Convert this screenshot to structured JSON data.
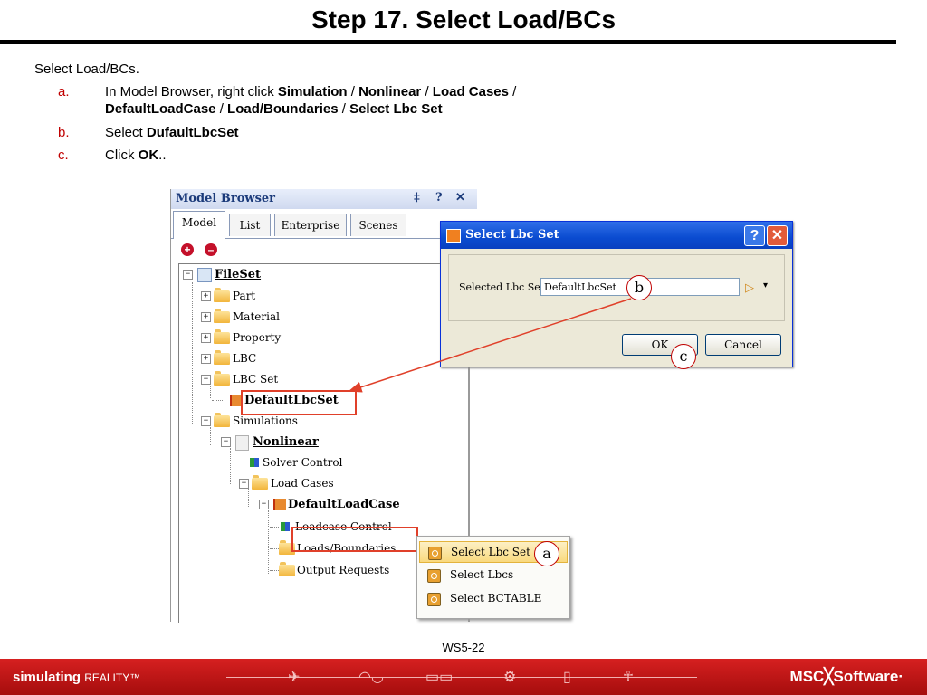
{
  "slide": {
    "title": "Step 17. Select Load/BCs",
    "intro": "Select Load/BCs.",
    "steps": [
      {
        "letter": "a.",
        "parts": [
          "In Model Browser, right click ",
          "Simulation",
          " / ",
          "Nonlinear",
          " / ",
          "Load Cases",
          " / ",
          "DefaultLoadCase",
          " / ",
          "Load/Boundaries",
          " / ",
          "Select Lbc Set"
        ]
      },
      {
        "letter": "b.",
        "parts": [
          "Select ",
          "DufaultLbcSet"
        ]
      },
      {
        "letter": "c.",
        "parts": [
          "Click ",
          "OK",
          ".."
        ]
      }
    ],
    "page_number": "WS5-22"
  },
  "model_browser": {
    "title": "Model Browser",
    "pin": "‡",
    "help": "?",
    "close": "✕",
    "tabs": [
      "Model",
      "List",
      "Enterprise",
      "Scenes"
    ],
    "add_symbol": "+",
    "remove_symbol": "–",
    "tree": {
      "fileset": "FileSet",
      "part": "Part",
      "material": "Material",
      "property": "Property",
      "lbc": "LBC",
      "lbc_set": "LBC Set",
      "default_lbc_set": "DefaultLbcSet",
      "simulations": "Simulations",
      "nonlinear": "Nonlinear",
      "solver_control": "Solver Control",
      "load_cases": "Load Cases",
      "default_load_case": "DefaultLoadCase",
      "loadcase_control": "Loadcase Control",
      "loads_boundaries": "Loads/Boundaries",
      "output_requests": "Output Requests"
    },
    "expander_plus": "+",
    "expander_minus": "−"
  },
  "dialog": {
    "title": "Select Lbc Set",
    "help": "?",
    "close": "✕",
    "label": "Selected Lbc Set:",
    "value": "DefaultLbcSet",
    "ok": "OK",
    "cancel": "Cancel",
    "pick_icon": "▷",
    "dropdown_icon": "▾"
  },
  "context_menu": {
    "items": [
      "Select Lbc Set",
      "Select Lbcs",
      "Select BCTABLE"
    ]
  },
  "callouts": {
    "a": "a",
    "b": "b",
    "c": "c"
  },
  "footer": {
    "slogan": "simulating",
    "slogan_reality": "REALITY™",
    "brand": "MSC╳Software·"
  },
  "colors": {
    "step_letter": "#c00000",
    "footer_red": "#c01414",
    "highlight_box": "#e0402a"
  }
}
